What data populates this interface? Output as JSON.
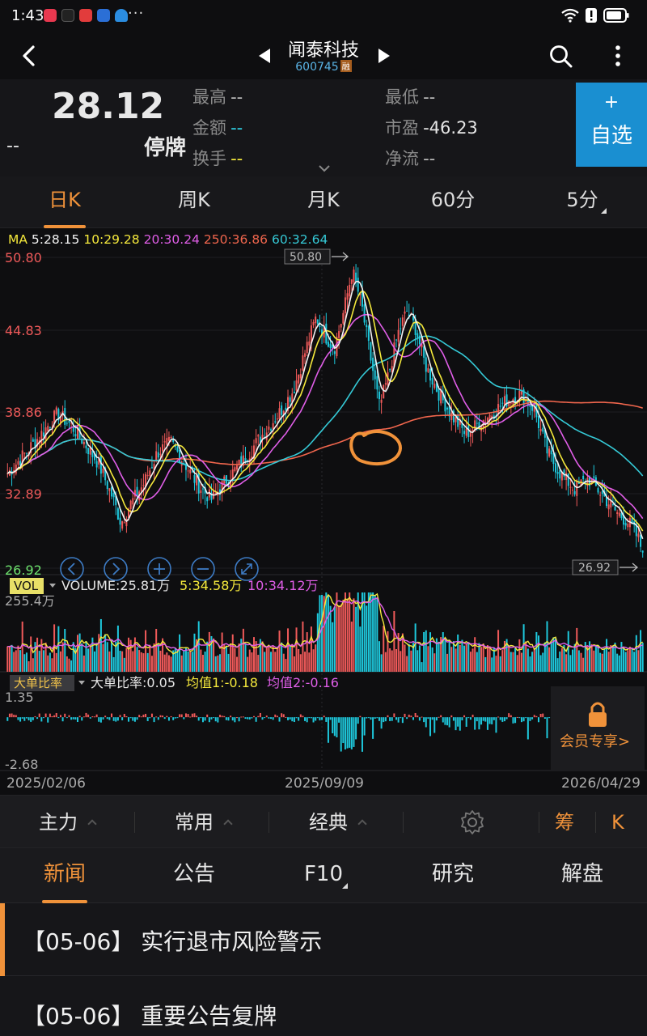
{
  "status_bar": {
    "time": "1:43",
    "dots": "···"
  },
  "header": {
    "stock_name": "闻泰科技",
    "stock_code": "600745",
    "margin_badge": "融"
  },
  "quote": {
    "price": "28.12",
    "change": "--",
    "status": "停牌",
    "high_label": "最高",
    "high_value": "--",
    "low_label": "最低",
    "low_value": "--",
    "amount_label": "金额",
    "amount_value": "--",
    "pe_label": "市盈",
    "pe_value": "-46.23",
    "turnover_label": "换手",
    "turnover_value": "--",
    "float_label": "净流",
    "float_value": "--",
    "add_plus": "+",
    "add_label": "自选"
  },
  "period_tabs": [
    "日K",
    "周K",
    "月K",
    "60分",
    "5分"
  ],
  "chart": {
    "ma_legend": {
      "ma": "MA",
      "ma5": "5:28.15",
      "ma10": "10:29.28",
      "ma20": "20:30.24",
      "ma250": "250:36.86",
      "ma60": "60:32.64"
    },
    "colors": {
      "up": "#f05a5a",
      "down": "#1ec8dc",
      "ma5": "#f2f2f2",
      "ma10": "#f5e93c",
      "ma20": "#e05ee8",
      "ma60": "#35c9d6",
      "ma250": "#f0664d"
    },
    "price_axis": [
      "50.80",
      "44.83",
      "38.86",
      "32.89",
      "26.92"
    ],
    "max_tag": "50.80",
    "min_tag": "26.92",
    "vol_badge": "VOL",
    "vol_legend": {
      "volume": "VOLUME:25.81万",
      "ma5": "5:34.58万",
      "ma10": "10:34.12万"
    },
    "vol_axis": "255.4万",
    "big_badge": "大单比率",
    "big_legend": {
      "ratio": "大单比率:0.05",
      "avg1": "均值1:-0.18",
      "avg2": "均值2:-0.16"
    },
    "big_axis_top": "1.35",
    "big_axis_bottom": "-2.68",
    "member_lock": "会员专享>",
    "dates": [
      "2025/02/06",
      "2025/09/09",
      "2026/04/29"
    ]
  },
  "chart_data": {
    "type": "candlestick",
    "ylim": [
      26.92,
      50.8
    ],
    "x_start": "2025/02/06",
    "x_mid": "2025/09/09",
    "x_end": "2026/04/29",
    "ma_latest": {
      "MA5": 28.15,
      "MA10": 29.28,
      "MA20": 30.24,
      "MA250": 36.86,
      "MA60": 32.64
    },
    "period_high": 50.8,
    "period_low": 26.92,
    "last_close": 28.12,
    "volume_latest": "25.81万",
    "volume_axis_max": "255.4万",
    "big_order_ratio": {
      "value": 0.05,
      "avg1": -0.18,
      "avg2": -0.16,
      "axis_max": 1.35,
      "axis_min": -2.68
    },
    "price_path": [
      [
        0,
        34.2
      ],
      [
        6,
        36.6
      ],
      [
        11,
        38.8
      ],
      [
        14,
        37.9
      ],
      [
        17,
        36.5
      ],
      [
        20,
        35.0
      ],
      [
        23,
        32.5
      ],
      [
        25,
        30.4
      ],
      [
        27,
        31.8
      ],
      [
        30,
        33.4
      ],
      [
        33,
        35.8
      ],
      [
        36,
        36.6
      ],
      [
        39,
        35.0
      ],
      [
        42,
        33.3
      ],
      [
        45,
        32.2
      ],
      [
        48,
        33.6
      ],
      [
        52,
        35.2
      ],
      [
        56,
        37.1
      ],
      [
        60,
        38.9
      ],
      [
        63,
        40.6
      ],
      [
        66,
        44.0
      ],
      [
        68,
        46.2
      ],
      [
        70,
        44.8
      ],
      [
        72,
        43.8
      ],
      [
        74,
        46.5
      ],
      [
        76,
        49.8
      ],
      [
        78,
        47.2
      ],
      [
        80,
        43.1
      ],
      [
        82,
        39.3
      ],
      [
        84,
        41.8
      ],
      [
        86,
        44.9
      ],
      [
        88,
        46.7
      ],
      [
        90,
        45.3
      ],
      [
        92,
        42.6
      ],
      [
        95,
        40.4
      ],
      [
        98,
        38.6
      ],
      [
        101,
        37.2
      ],
      [
        104,
        38.1
      ],
      [
        107,
        38.9
      ],
      [
        110,
        39.8
      ],
      [
        113,
        40.3
      ],
      [
        116,
        39.2
      ],
      [
        119,
        35.8
      ],
      [
        122,
        34.1
      ],
      [
        125,
        33.0
      ],
      [
        128,
        33.8
      ],
      [
        131,
        32.6
      ],
      [
        134,
        31.3
      ],
      [
        137,
        30.4
      ],
      [
        139,
        29.2
      ],
      [
        140,
        28.12
      ]
    ]
  },
  "toolbar": {
    "main": "主力",
    "common": "常用",
    "classic": "经典",
    "chips": "筹",
    "k": "K"
  },
  "news_tabs": [
    "新闻",
    "公告",
    "F10",
    "研究",
    "解盘"
  ],
  "news": [
    {
      "date": "【05-06】",
      "title": "实行退市风险警示"
    },
    {
      "date": "【05-06】",
      "title": "重要公告复牌"
    }
  ]
}
